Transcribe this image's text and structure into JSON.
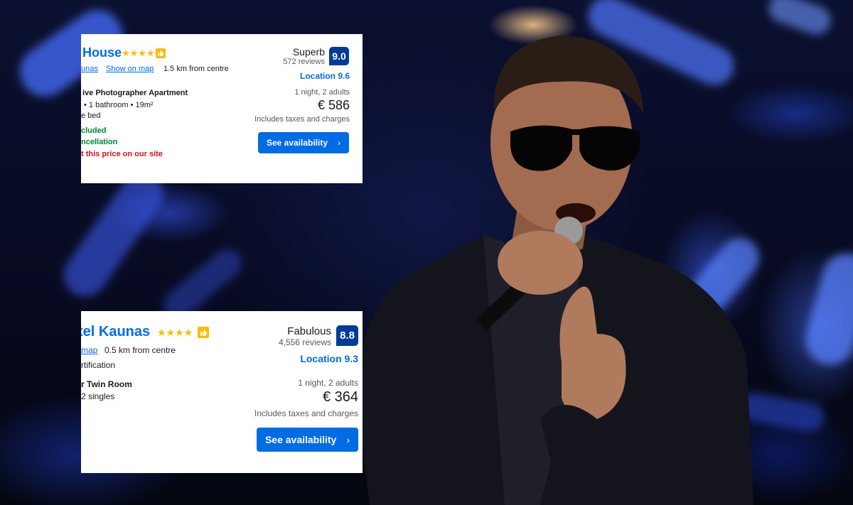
{
  "listings": [
    {
      "name_visible": "House",
      "stars": "★★★★",
      "location_link": "unas",
      "map_link": "Show on map",
      "distance": "1.5 km from centre",
      "room_name": "ive Photographer Apartment",
      "room_details": "•  1 bathroom  •  19m²",
      "bed": "e bed",
      "included": "cluded",
      "cancellation": "ncellation",
      "price_note": "t this price on our site",
      "rating_word": "Superb",
      "reviews": "572 reviews",
      "score": "9.0",
      "location_score": "Location 9.6",
      "stay": "1 night, 2 adults",
      "price": "€ 586",
      "taxes": "Includes taxes and charges",
      "cta": "See availability",
      "cta_icon": "chevron-right-icon"
    },
    {
      "name_visible": "tel Kaunas",
      "stars": "★★★★",
      "map_link": "map",
      "distance": "0.5 km from centre",
      "certification": "rtification",
      "room_name": "r Twin Room",
      "bed": "2 singles",
      "rating_word": "Fabulous",
      "reviews": "4,556 reviews",
      "score": "8.8",
      "location_score": "Location 9.3",
      "stay": "1 night, 2 adults",
      "price": "€ 364",
      "taxes": "Includes taxes and charges",
      "cta": "See availability",
      "cta_icon": "chevron-right-icon"
    }
  ],
  "colors": {
    "link_blue": "#006ce4",
    "score_navy": "#003b95",
    "star_yellow": "#febb02",
    "success_green": "#008234",
    "alert_red": "#d4111e"
  }
}
